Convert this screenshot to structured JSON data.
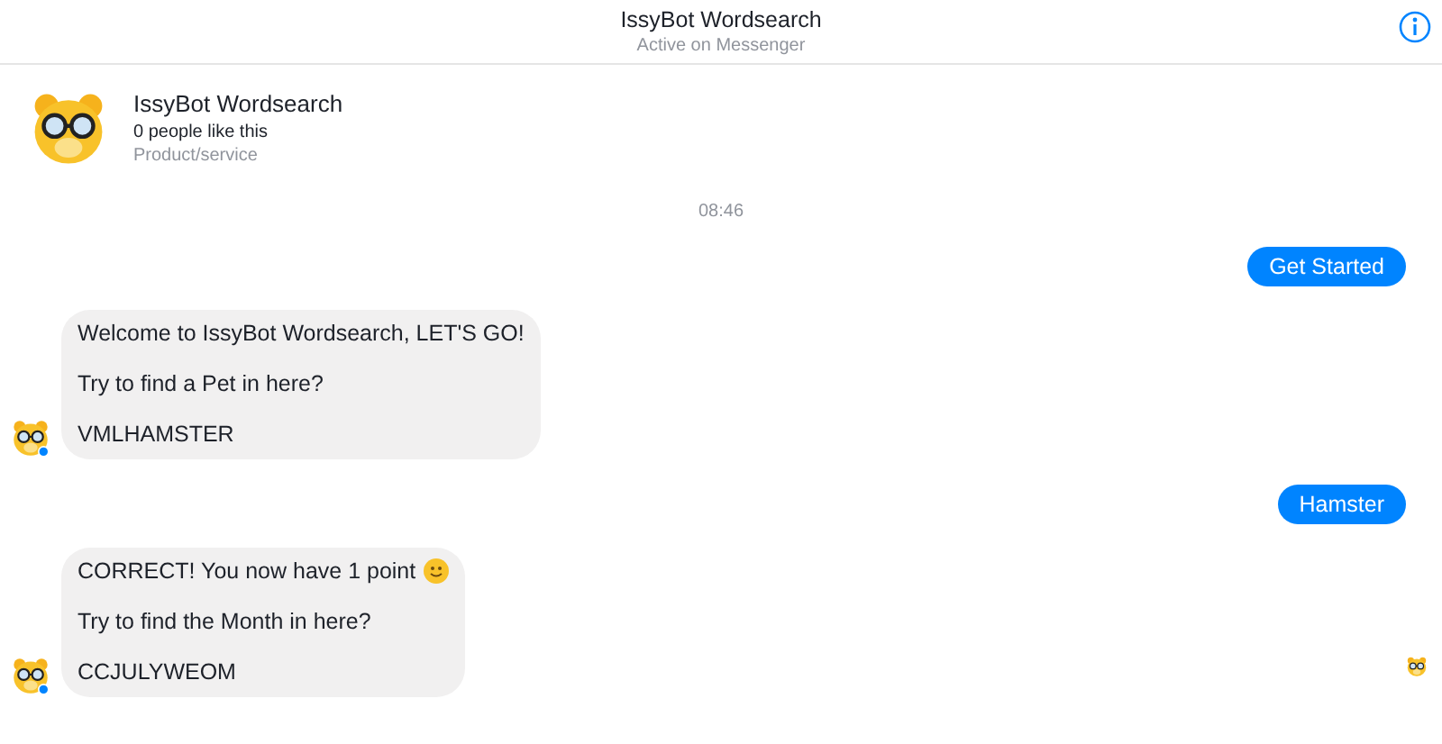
{
  "header": {
    "title": "IssyBot Wordsearch",
    "subtitle": "Active on Messenger"
  },
  "profile": {
    "name": "IssyBot Wordsearch",
    "likes": "0 people like this",
    "category": "Product/service"
  },
  "timestamp": "08:46",
  "messages": [
    {
      "kind": "user",
      "text": "Get Started"
    },
    {
      "kind": "bot",
      "lines": [
        {
          "text": "Welcome to IssyBot Wordsearch, LET'S GO!",
          "smiley": false
        },
        {
          "text": "Try to find a Pet in here?",
          "smiley": false
        },
        {
          "text": "VMLHAMSTER",
          "smiley": false
        }
      ]
    },
    {
      "kind": "user",
      "text": "Hamster"
    },
    {
      "kind": "bot",
      "lines": [
        {
          "text": "CORRECT! You now have 1 point",
          "smiley": true
        },
        {
          "text": "Try to find the Month in here?",
          "smiley": false
        },
        {
          "text": "CCJULYWEOM",
          "smiley": false
        }
      ]
    }
  ]
}
